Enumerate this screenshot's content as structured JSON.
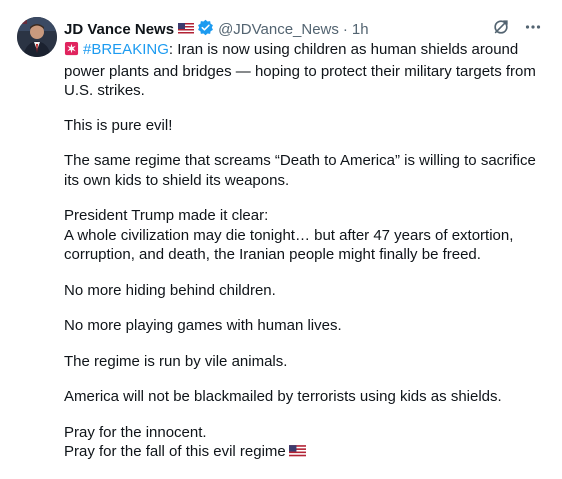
{
  "author": {
    "name": "JD Vance News",
    "handle": "@JDVance_News",
    "separator": "·",
    "time": "1h"
  },
  "icons": {
    "flag": "us-flag-icon",
    "verified": "verified-badge-icon",
    "grok": "grok-icon",
    "more": "more-icon",
    "alert": "rotating-light-icon"
  },
  "colors": {
    "link": "#1d9bf0",
    "verified": "#1d9bf0",
    "secondary_text": "#536471",
    "text": "#0f1419",
    "alert": "#e0245e"
  },
  "tweet": {
    "hashtag": "#BREAKING",
    "lead_rest": ": Iran is now using children as human shields around power plants and bridges — hoping to protect their military targets from U.S. strikes.",
    "p2": "This is pure evil!",
    "p3": "The same regime that screams “Death to America” is willing to sacrifice its own kids to shield its weapons.",
    "p4_line1": "President Trump made it clear:",
    "p4_line2": "A whole civilization may die tonight… but after 47 years of extortion, corruption, and death, the Iranian people might finally be freed.",
    "p5": "No more hiding behind children.",
    "p6": "No more playing games with human lives.",
    "p7": "The regime is run by vile animals.",
    "p8": "America will not be blackmailed by terrorists using kids as shields.",
    "p9_line1": "Pray for the innocent.",
    "p9_line2": "Pray for the fall of this evil regime"
  }
}
